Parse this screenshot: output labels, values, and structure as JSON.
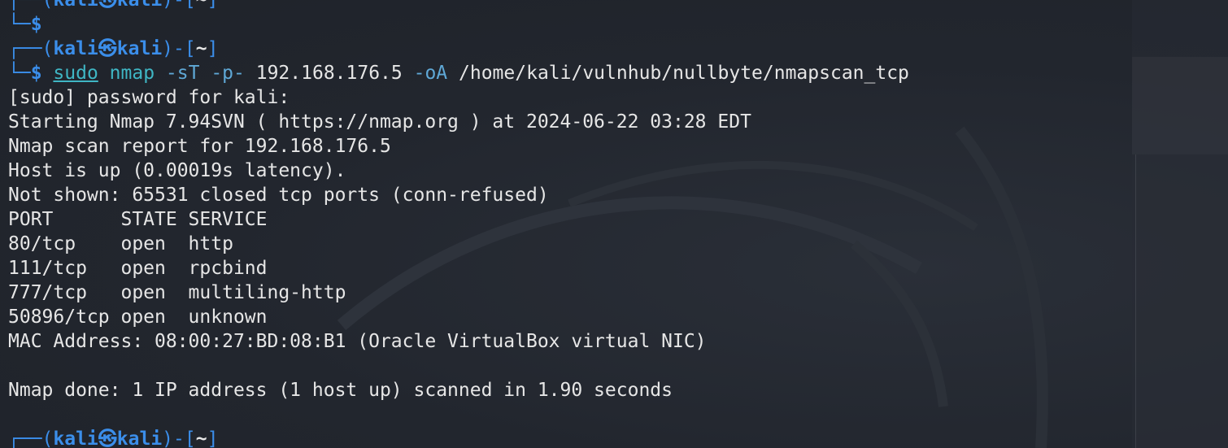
{
  "prompt": {
    "frame_top": "┌──(",
    "user": "kali",
    "skull": "㉿",
    "host": "kali",
    "frame_mid": ")-[",
    "dir": "~",
    "frame_end": "]",
    "frame_bottom": "└─",
    "dollar": "$"
  },
  "command": {
    "sudo": "sudo",
    "nmap": "nmap",
    "flag_st": "-sT",
    "flag_p": "-p-",
    "target": "192.168.176.5",
    "flag_oa": "-oA",
    "outpath": "/home/kali/vulnhub/nullbyte/nmapscan_tcp"
  },
  "output": [
    "[sudo] password for kali:",
    "Starting Nmap 7.94SVN ( https://nmap.org ) at 2024-06-22 03:28 EDT",
    "Nmap scan report for 192.168.176.5",
    "Host is up (0.00019s latency).",
    "Not shown: 65531 closed tcp ports (conn-refused)",
    "PORT      STATE SERVICE",
    "80/tcp    open  http",
    "111/tcp   open  rpcbind",
    "777/tcp   open  multiling-http",
    "50896/tcp open  unknown",
    "MAC Address: 08:00:27:BD:08:B1 (Oracle VirtualBox virtual NIC)",
    "",
    "Nmap done: 1 IP address (1 host up) scanned in 1.90 seconds",
    ""
  ],
  "colors": {
    "background": "#22262e",
    "prompt_blue": "#3b8eea",
    "command_cyan": "#3fb6c4",
    "text": "#e6e6e6"
  }
}
